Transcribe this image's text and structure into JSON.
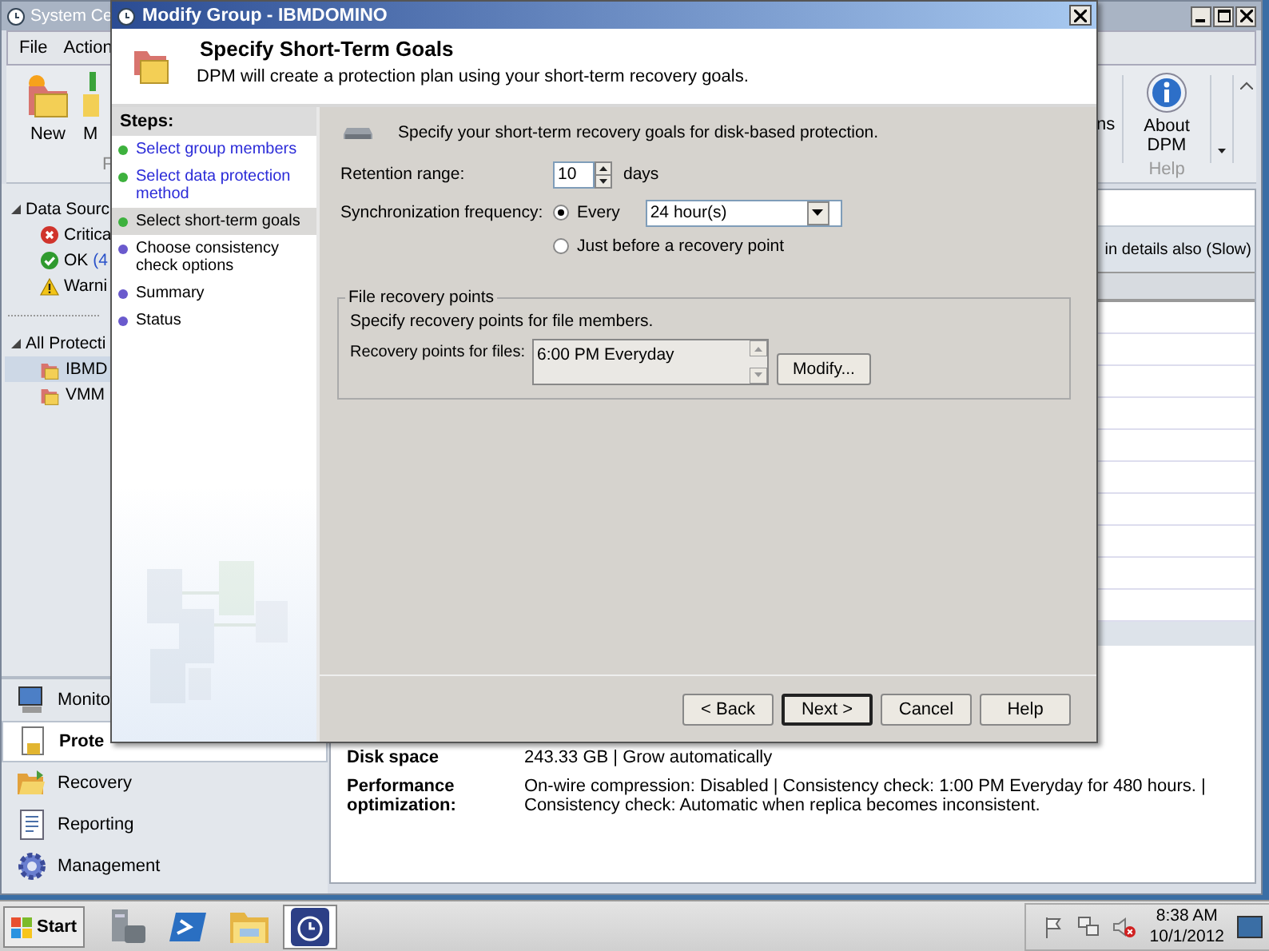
{
  "main_window": {
    "title": "System Ce",
    "menu": [
      "File",
      "Action"
    ],
    "ribbon": {
      "buttons": [
        {
          "label": "New",
          "kind": "new"
        },
        {
          "label": "M",
          "kind": "modify"
        }
      ],
      "group_label": "F",
      "right_fragment": "ns",
      "about_button": "About DPM",
      "help_group_label": "Help"
    },
    "tree": [
      {
        "label": "Data Sourc",
        "expanded": true,
        "children": [
          {
            "label": "Critica",
            "kind": "error",
            "selected": false
          },
          {
            "label": "OK",
            "count": "(4",
            "kind": "ok",
            "selected": false
          },
          {
            "label": "Warni",
            "kind": "warning",
            "selected": false
          }
        ]
      },
      {
        "label": "All Protecti",
        "expanded": true,
        "children": [
          {
            "label": "IBMD",
            "kind": "group",
            "selected": true
          },
          {
            "label": "VMM",
            "kind": "group",
            "selected": false
          }
        ]
      }
    ],
    "nav": [
      {
        "label": "Monito",
        "kind": "monitoring",
        "selected": false
      },
      {
        "label": "Prote",
        "kind": "protection",
        "selected": true
      },
      {
        "label": "Recovery",
        "kind": "recovery",
        "selected": false
      },
      {
        "label": "Reporting",
        "kind": "reporting",
        "selected": false
      },
      {
        "label": "Management",
        "kind": "management",
        "selected": false
      }
    ],
    "list_hint": "in details also (Slow)",
    "details": [
      {
        "label": "Disk space",
        "value": "243.33 GB | Grow automatically"
      },
      {
        "label": "Performance optimization:",
        "value": "On-wire compression: Disabled | Consistency check: 1:00 PM Everyday for 480 hours. | Consistency check: Automatic when replica becomes inconsistent."
      }
    ]
  },
  "dialog": {
    "title": "Modify Group - IBMDOMINO",
    "heading": "Specify Short-Term Goals",
    "subheading": "DPM will create a protection plan using your short-term recovery goals.",
    "steps_title": "Steps:",
    "steps": [
      {
        "label": "Select group members",
        "completed": true,
        "selected": false
      },
      {
        "label": "Select data protection method",
        "completed": true,
        "selected": false
      },
      {
        "label": "Select short-term goals",
        "completed": true,
        "selected": true
      },
      {
        "label": "Choose consistency check options",
        "completed": false,
        "selected": false
      },
      {
        "label": "Summary",
        "completed": false,
        "selected": false
      },
      {
        "label": "Status",
        "completed": false,
        "selected": false
      }
    ],
    "intro": "Specify your short-term recovery goals for disk-based protection.",
    "retention": {
      "label": "Retention range:",
      "value": "10",
      "unit": "days"
    },
    "sync": {
      "label": "Synchronization frequency:",
      "options": [
        {
          "label": "Every",
          "selected": true
        },
        {
          "label": "Just before a recovery point",
          "selected": false
        }
      ],
      "frequency": "24 hour(s)"
    },
    "file_points": {
      "title": "File recovery points",
      "description": "Specify recovery points for file members.",
      "label": "Recovery points for files:",
      "items": [
        "6:00 PM Everyday"
      ],
      "button": "Modify..."
    },
    "buttons": [
      {
        "label": "< Back",
        "default": false
      },
      {
        "label": "Next >",
        "default": true
      },
      {
        "label": "Cancel",
        "default": false
      },
      {
        "label": "Help",
        "default": false
      }
    ]
  },
  "taskbar": {
    "start": "Start",
    "apps": [
      {
        "kind": "server",
        "selected": false
      },
      {
        "kind": "shell",
        "selected": false
      },
      {
        "kind": "folder",
        "selected": false
      },
      {
        "kind": "dpm",
        "selected": true
      }
    ],
    "tray": [
      {
        "kind": "flag"
      },
      {
        "kind": "network"
      },
      {
        "kind": "volume-muted"
      }
    ],
    "time": "8:38 AM",
    "date": "10/1/2012"
  }
}
